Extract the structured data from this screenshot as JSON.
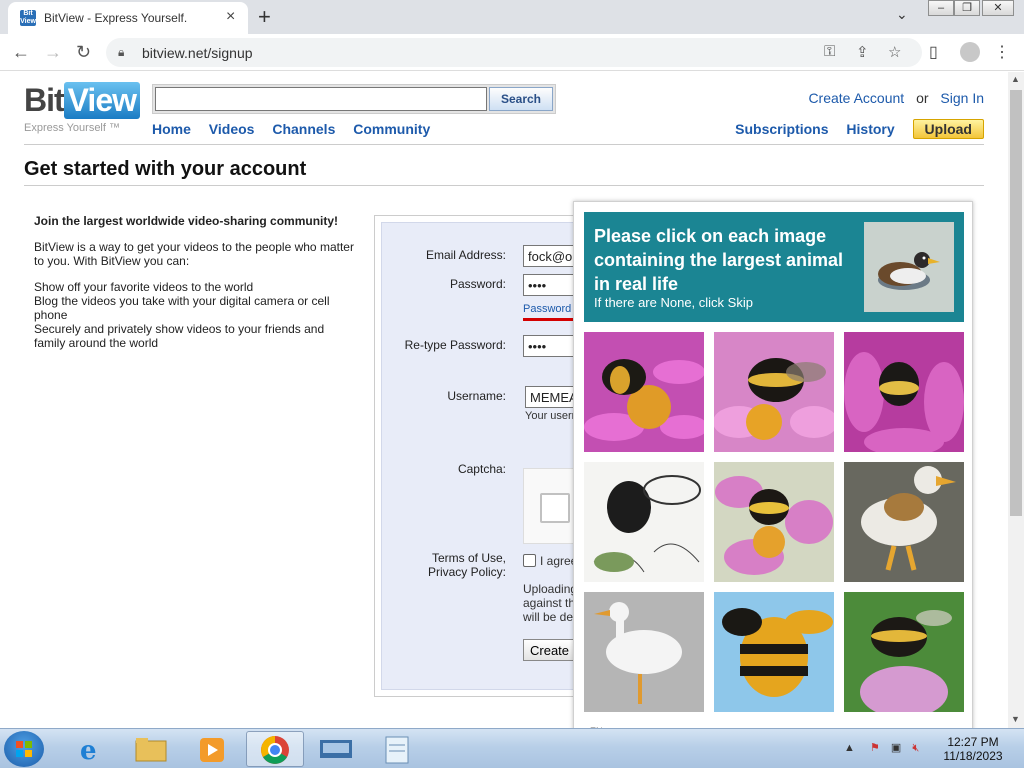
{
  "browser": {
    "tab_title": "BitView - Express Yourself.",
    "favicon_text": "Bit View",
    "url": "bitview.net/signup"
  },
  "site": {
    "logo_bit": "Bit",
    "logo_view": "View",
    "tagline": "Express Yourself ™",
    "search_button": "Search",
    "search_value": "",
    "nav": [
      "Home",
      "Videos",
      "Channels",
      "Community"
    ],
    "create_account": "Create Account",
    "or": "or",
    "sign_in": "Sign In",
    "user_links": [
      "Subscriptions",
      "History"
    ],
    "upload": "Upload"
  },
  "page": {
    "heading": "Get started with your account",
    "intro_strong": "Join the largest worldwide video-sharing community!",
    "intro_p1": "BitView is a way to get your videos to the people who matter to you. With BitView you can:",
    "intro_list": [
      "Show off your favorite videos to the world",
      "Blog the videos you take with your digital camera or cell phone",
      "Securely and privately show videos to your friends and family around the world"
    ]
  },
  "form": {
    "email_label": "Email Address:",
    "email_value": "fock@ou",
    "password_label": "Password:",
    "password_value": "••••",
    "password_strength": "Password s",
    "retype_label": "Re-type Password:",
    "retype_value": "••••",
    "username_label": "Username:",
    "username_value": "MEMEA",
    "username_hint": "Your userna",
    "captcha_label": "Captcha:",
    "terms_label_1": "Terms of Use,",
    "terms_label_2": "Privacy Policy:",
    "agree_text": "I agree",
    "upload_note_1": "Uploading",
    "upload_note_2": "against the",
    "upload_note_3": "will be dele",
    "create_button": "Create n"
  },
  "captcha": {
    "prompt_line": "Please click on each image containing the largest animal in real life",
    "skip_hint": "If there are None, click Skip",
    "sample_icon": "duck-icon",
    "cells": [
      {
        "icon": "bee-on-pink-flower"
      },
      {
        "icon": "bee-on-pink-flower"
      },
      {
        "icon": "bee-on-purple-flower"
      },
      {
        "icon": "fly-sketch"
      },
      {
        "icon": "bee-on-pink-flower"
      },
      {
        "icon": "duck-toy"
      },
      {
        "icon": "white-bird"
      },
      {
        "icon": "bee-cartoon"
      },
      {
        "icon": "bee-on-thistle"
      }
    ],
    "footer_text": "EN"
  },
  "taskbar": {
    "time": "12:27 PM",
    "date": "11/18/2023",
    "apps": [
      "internet-explorer-icon",
      "file-explorer-icon",
      "media-player-icon",
      "chrome-icon",
      "keyboard-icon",
      "notepad-icon"
    ]
  },
  "colors": {
    "link": "#1d5aab",
    "captcha_header": "#1b8593",
    "upload_button": "#f3c53a",
    "password_strength_bar": "#d40000"
  }
}
